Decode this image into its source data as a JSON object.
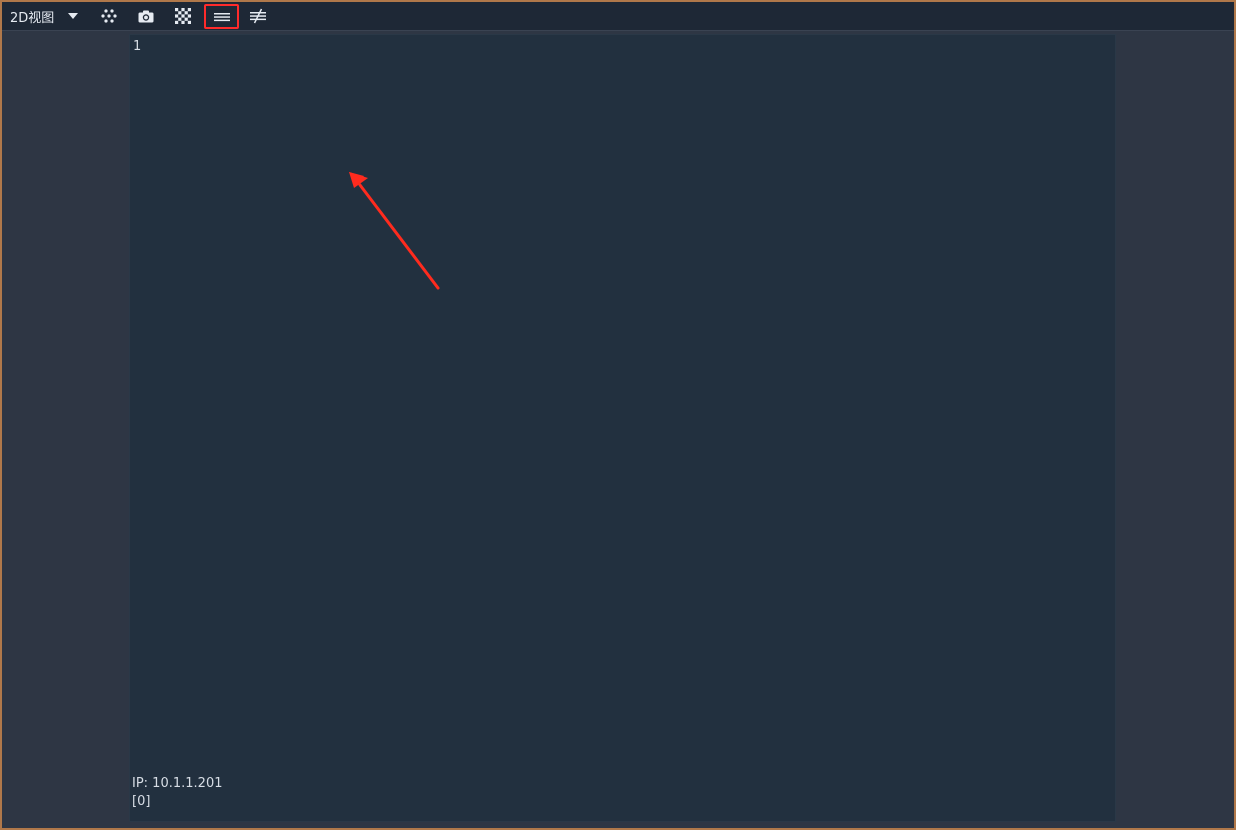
{
  "toolbar": {
    "view_mode_label": "2D视图",
    "buttons": [
      {
        "icon": "dots-grid-icon"
      },
      {
        "icon": "camera-icon"
      },
      {
        "icon": "checkerboard-icon"
      },
      {
        "icon": "lines-icon",
        "highlighted": true
      },
      {
        "icon": "not-equal-lines-icon"
      }
    ]
  },
  "viewport": {
    "channel_number": "1",
    "ip_label": "IP: 10.1.1.201",
    "status": "[0]"
  },
  "colors": {
    "toolbar_bg": "#1e2836",
    "pane_bg": "#22303f",
    "frame_bg": "#2e3644",
    "frame_border": "#b0784a",
    "highlight": "#ff2b2b",
    "annotation_arrow": "#ff2b1e"
  }
}
